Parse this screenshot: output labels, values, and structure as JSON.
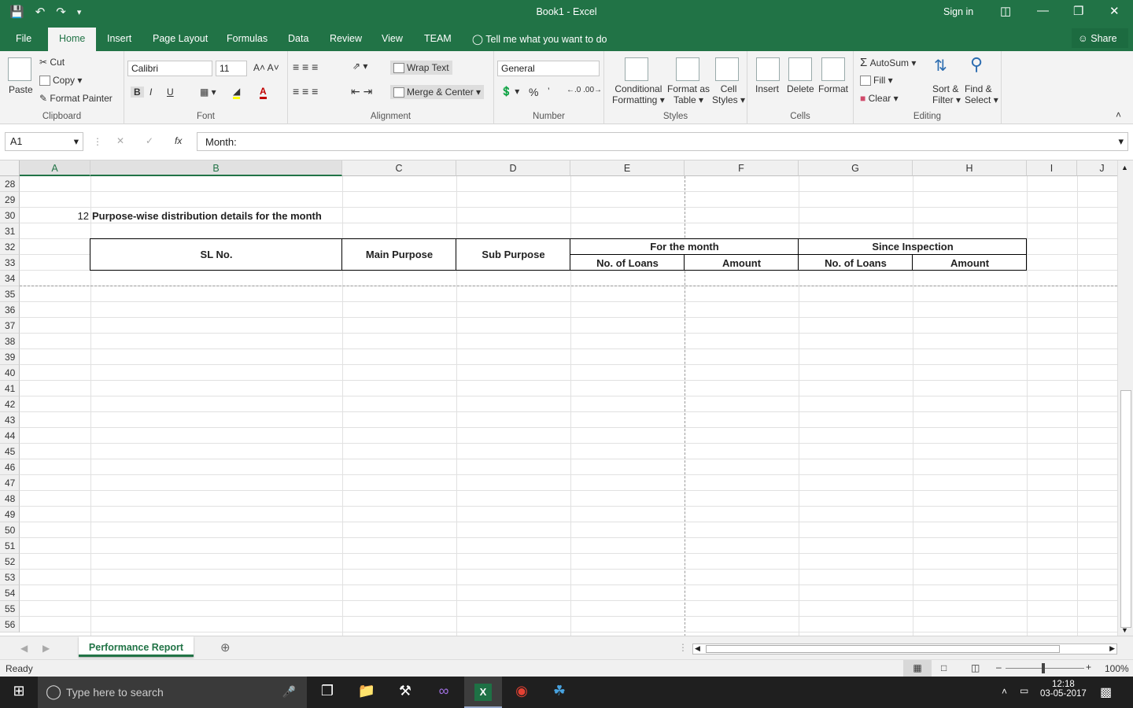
{
  "window": {
    "title": "Book1  -  Excel",
    "sign_in": "Sign in",
    "share": "Share"
  },
  "tabs": [
    "File",
    "Home",
    "Insert",
    "Page Layout",
    "Formulas",
    "Data",
    "Review",
    "View",
    "TEAM"
  ],
  "tell_me": "Tell me what you want to do",
  "ribbon": {
    "clipboard": {
      "label": "Clipboard",
      "paste": "Paste",
      "cut": "Cut",
      "copy": "Copy",
      "format_painter": "Format Painter"
    },
    "font": {
      "label": "Font",
      "name": "Calibri",
      "size": "11",
      "bold": "B",
      "italic": "I",
      "underline": "U"
    },
    "alignment": {
      "label": "Alignment",
      "wrap": "Wrap Text",
      "merge": "Merge & Center"
    },
    "number": {
      "label": "Number",
      "format": "General",
      "percent": "%"
    },
    "styles": {
      "label": "Styles",
      "cond1": "Conditional",
      "cond2": "Formatting",
      "fmt1": "Format as",
      "fmt2": "Table",
      "cell1": "Cell",
      "cell2": "Styles"
    },
    "cells": {
      "label": "Cells",
      "insert": "Insert",
      "delete": "Delete",
      "format": "Format"
    },
    "editing": {
      "label": "Editing",
      "autosum": "AutoSum",
      "fill": "Fill",
      "clear": "Clear",
      "sort1": "Sort &",
      "sort2": "Filter",
      "find1": "Find &",
      "find2": "Select"
    }
  },
  "formula_bar": {
    "name_box": "A1",
    "formula": "Month:",
    "fx": "fx"
  },
  "columns": [
    "A",
    "B",
    "C",
    "D",
    "E",
    "F",
    "G",
    "H",
    "I",
    "J"
  ],
  "rows": [
    "28",
    "29",
    "30",
    "31",
    "32",
    "33",
    "34",
    "35",
    "36",
    "37",
    "38",
    "39",
    "40",
    "41",
    "42",
    "43",
    "44",
    "45",
    "46",
    "47",
    "48",
    "49",
    "50",
    "51",
    "52",
    "53",
    "54",
    "55",
    "56"
  ],
  "cells": {
    "a30": "12",
    "b30": "Purpose-wise distribution details for the month",
    "sl_no": "SL No.",
    "main_purpose": "Main Purpose",
    "sub_purpose": "Sub Purpose",
    "for_month": "For the month",
    "since_inspection": "Since Inspection",
    "no_loans_1": "No. of Loans",
    "amount_1": "Amount",
    "no_loans_2": "No. of Loans",
    "amount_2": "Amount"
  },
  "sheet_tab": "Performance Report",
  "status": {
    "ready": "Ready",
    "zoom": "100%"
  },
  "taskbar": {
    "search": "Type here to search",
    "time": "12:18",
    "date": "03-05-2017"
  }
}
